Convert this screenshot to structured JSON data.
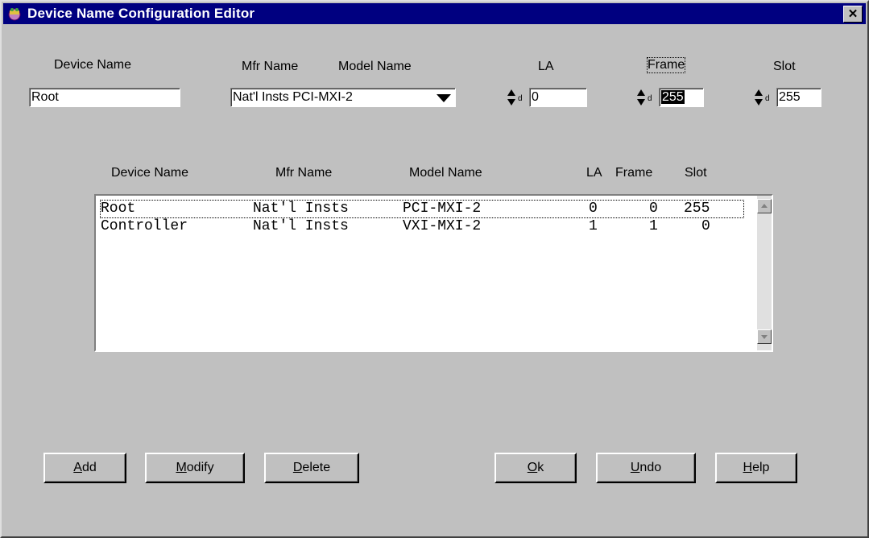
{
  "window": {
    "title": "Device Name Configuration Editor",
    "close_glyph": "✕"
  },
  "header_labels": {
    "device_name": "Device Name",
    "mfr_name": "Mfr Name",
    "model_name": "Model Name",
    "la": "LA",
    "frame": "Frame",
    "slot": "Slot"
  },
  "fields": {
    "device_name_value": "Root",
    "mfr_model_value": "Nat'l Insts  PCI-MXI-2",
    "la_value": "0",
    "frame_value": "255",
    "slot_value": "255",
    "radix_marker": "d"
  },
  "list_headers": {
    "device_name": "Device Name",
    "mfr_name": "Mfr Name",
    "model_name": "Model Name",
    "la": "LA",
    "frame": "Frame",
    "slot": "Slot"
  },
  "list_rows": [
    {
      "device": "Root",
      "mfr": "Nat'l Insts",
      "model": "PCI-MXI-2",
      "la": "0",
      "frame": "0",
      "slot": "255"
    },
    {
      "device": "Controller",
      "mfr": "Nat'l Insts",
      "model": "VXI-MXI-2",
      "la": "1",
      "frame": "1",
      "slot": "0"
    }
  ],
  "buttons": {
    "add": {
      "mn": "A",
      "rest": "dd"
    },
    "modify": {
      "mn": "M",
      "rest": "odify"
    },
    "delete": {
      "mn": "D",
      "rest": "elete"
    },
    "ok": {
      "mn": "O",
      "rest": "k"
    },
    "undo": {
      "mn": "U",
      "rest": "ndo"
    },
    "help": {
      "mn": "H",
      "rest": "elp"
    }
  },
  "colors": {
    "titlebar": "#000080",
    "dialog_bg": "#c0c0c0"
  },
  "icons": [
    "app-icon",
    "close-icon",
    "dropdown-arrow-icon",
    "spin-arrows-icon",
    "scroll-up-icon",
    "scroll-down-icon"
  ]
}
